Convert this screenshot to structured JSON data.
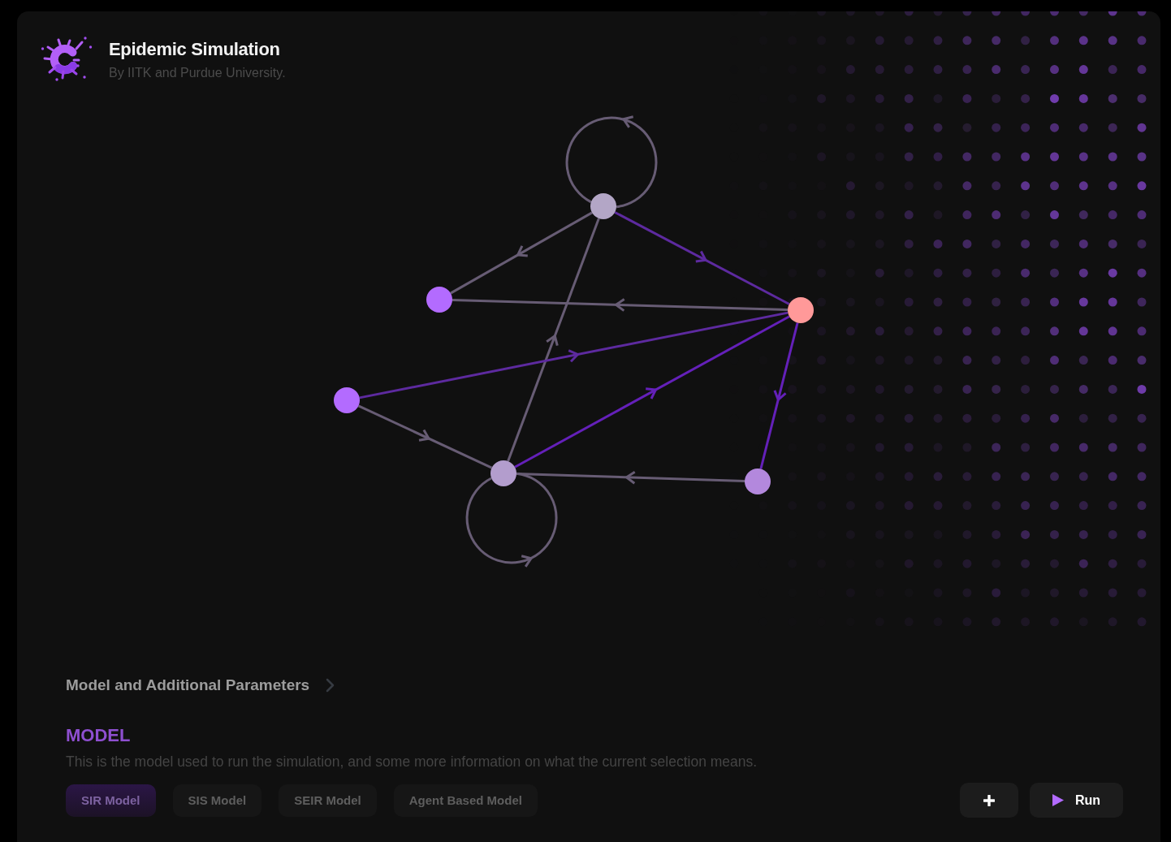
{
  "header": {
    "title": "Epidemic Simulation",
    "subtitle": "By IITK and Purdue University."
  },
  "graph": {
    "nodes": [
      {
        "color": "#b3a6c6"
      },
      {
        "color": "#b36bff"
      },
      {
        "color": "#ff9999"
      },
      {
        "color": "#b36bff"
      },
      {
        "color": "#b39dcd"
      },
      {
        "color": "#b388dd"
      }
    ],
    "edges": [
      {
        "kind": "loop",
        "color": "#675c74"
      },
      {
        "kind": "link",
        "color": "#675c74"
      },
      {
        "kind": "link",
        "color": "#5d2a9f"
      },
      {
        "kind": "link",
        "color": "#675c74"
      },
      {
        "kind": "link",
        "color": "#675c74"
      },
      {
        "kind": "link",
        "color": "#5d2a9f"
      },
      {
        "kind": "link",
        "color": "#675c74"
      },
      {
        "kind": "link",
        "color": "#6420b9"
      },
      {
        "kind": "link",
        "color": "#6420b9"
      },
      {
        "kind": "link",
        "color": "#675c74"
      },
      {
        "kind": "loop",
        "color": "#675c74"
      }
    ]
  },
  "parameters": {
    "heading": "Model and Additional Parameters"
  },
  "model": {
    "title": "MODEL",
    "description": "This is the model used to run the simulation, and some more information on what the current selection means.",
    "options": [
      {
        "label": "SIR Model",
        "selected": true
      },
      {
        "label": "SIS Model",
        "selected": false
      },
      {
        "label": "SEIR Model",
        "selected": false
      },
      {
        "label": "Agent Based Model",
        "selected": false
      }
    ]
  },
  "actions": {
    "run_label": "Run"
  }
}
